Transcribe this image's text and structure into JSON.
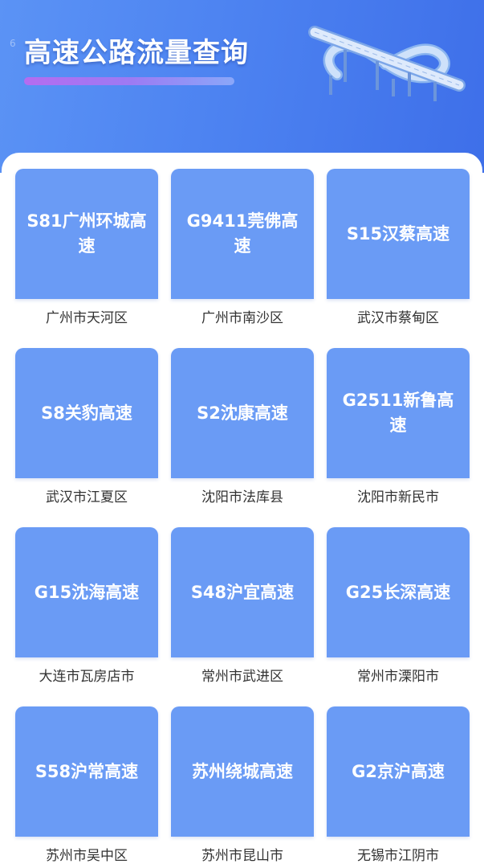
{
  "header": {
    "stub": "6",
    "title": "高速公路流量查询"
  },
  "roads": [
    {
      "name": "S81广州环城高速",
      "location": "广州市天河区"
    },
    {
      "name": "G9411莞佛高速",
      "location": "广州市南沙区"
    },
    {
      "name": "S15汉蔡高速",
      "location": "武汉市蔡甸区"
    },
    {
      "name": "S8关豹高速",
      "location": "武汉市江夏区"
    },
    {
      "name": "S2沈康高速",
      "location": "沈阳市法库县"
    },
    {
      "name": "G2511新鲁高速",
      "location": "沈阳市新民市"
    },
    {
      "name": "G15沈海高速",
      "location": "大连市瓦房店市"
    },
    {
      "name": "S48沪宜高速",
      "location": "常州市武进区"
    },
    {
      "name": "G25长深高速",
      "location": "常州市溧阳市"
    },
    {
      "name": "S58沪常高速",
      "location": "苏州市吴中区"
    },
    {
      "name": "苏州绕城高速",
      "location": "苏州市昆山市"
    },
    {
      "name": "G2京沪高速",
      "location": "无锡市江阴市"
    }
  ],
  "colors": {
    "header_blue": "#4d83f1",
    "card_blue": "#6a9bf5",
    "title_accent": "#b46cf0"
  },
  "icons": {
    "header_illustration": "highway-interchange-icon"
  }
}
